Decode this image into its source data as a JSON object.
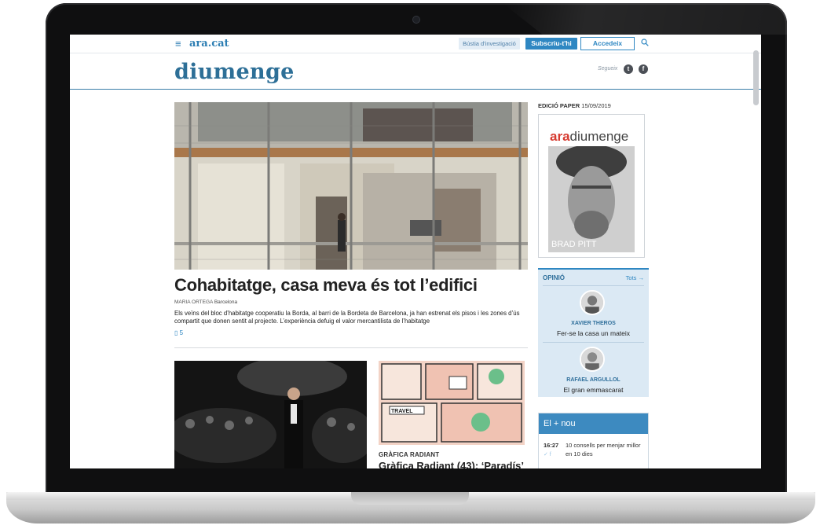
{
  "header": {
    "menu_icon": "hamburger-icon",
    "logo": "ara.cat",
    "investigation_button": "Bústia d'investigació",
    "subscribe_button": "Subscriu-t'hi",
    "login_button": "Accedeix",
    "search_icon": "search-icon"
  },
  "section": {
    "title": "diumenge",
    "follow_label": "Segueix",
    "social_icons": [
      "twitter-icon",
      "facebook-icon"
    ]
  },
  "main_article": {
    "headline": "Cohabitatge, casa meva és tot l’edifici",
    "author": "MARIA ORTEGA",
    "location": "Barcelona",
    "summary": "Els veïns del bloc d’habitatge cooperatiu la Borda, al barri de la Bordeta de Barcelona, ja han estrenat els pisos i les zones d’ús compartit que donen sentit al projecte. L’experiència defuig el valor mercantilista de l’habitatge",
    "comment_count": "5"
  },
  "secondary_article": {
    "kicker": "GRÀFICA RADIANT",
    "headline": "Gràfica Radiant (43): ‘Paradís’",
    "illustration_text": "TRAVEL"
  },
  "paper_edition": {
    "label": "EDICIÓ PAPER",
    "date": "15/09/2019",
    "cover_brand_a": "ara",
    "cover_brand_b": "diumenge",
    "cover_text": "BRAD PITT"
  },
  "opinion": {
    "title": "OPINIÓ",
    "all_link": "Tots →",
    "items": [
      {
        "author": "XAVIER THEROS",
        "title": "Fer-se la casa un mateix"
      },
      {
        "author": "RAFAEL ARGULLOL",
        "title": "El gran emmascarat"
      }
    ]
  },
  "most_read": {
    "title": "El + nou",
    "items": [
      {
        "time": "16:27",
        "text": "10 consells per menjar millor en 10 dies"
      }
    ]
  },
  "colors": {
    "brand_blue": "#2f87c2",
    "section_blue": "#2d6f97",
    "opinion_bg": "#dbe9f4",
    "cover_red": "#d63a2f"
  }
}
